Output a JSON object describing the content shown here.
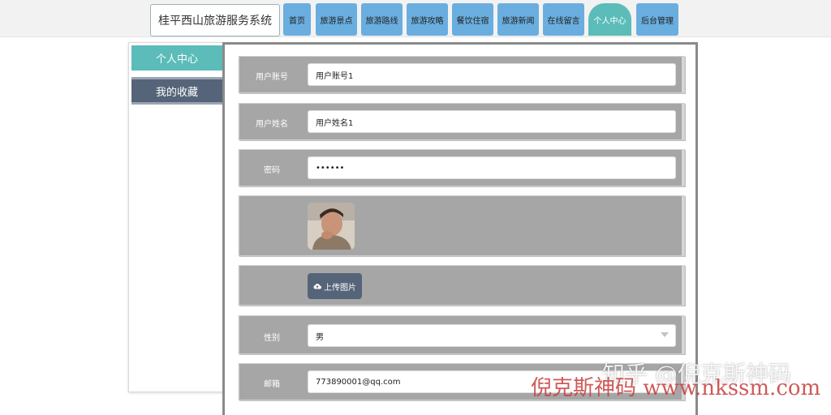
{
  "header": {
    "brand": "桂平西山旅游服务系统",
    "nav": [
      {
        "label": "首页"
      },
      {
        "label": "旅游景点"
      },
      {
        "label": "旅游路线"
      },
      {
        "label": "旅游攻略"
      },
      {
        "label": "餐饮住宿"
      },
      {
        "label": "旅游新闻"
      },
      {
        "label": "在线留言"
      },
      {
        "label": "个人中心",
        "active": true
      },
      {
        "label": "后台管理"
      }
    ]
  },
  "sidebar": {
    "items": [
      {
        "label": "个人中心",
        "active": true
      },
      {
        "label": "我的收藏"
      }
    ]
  },
  "form": {
    "username_label": "用户账号",
    "username_value": "用户账号1",
    "name_label": "用户姓名",
    "name_value": "用户姓名1",
    "password_label": "密码",
    "password_value": "••••••",
    "upload_label": "上传图片",
    "gender_label": "性别",
    "gender_value": "男",
    "email_label": "邮箱",
    "email_value": "773890001@qq.com"
  },
  "watermark": {
    "zhihu": "知乎 @倪克斯神码",
    "site": "倪克斯神码 www.nkssm.com"
  },
  "icons": {
    "upload": "cloud-upload-icon",
    "select": "chevron-down-icon"
  },
  "colors": {
    "nav_blue": "#6aaee0",
    "teal_active": "#5bbcb9",
    "slate": "#556479",
    "row_gray": "#a6a6a6"
  }
}
